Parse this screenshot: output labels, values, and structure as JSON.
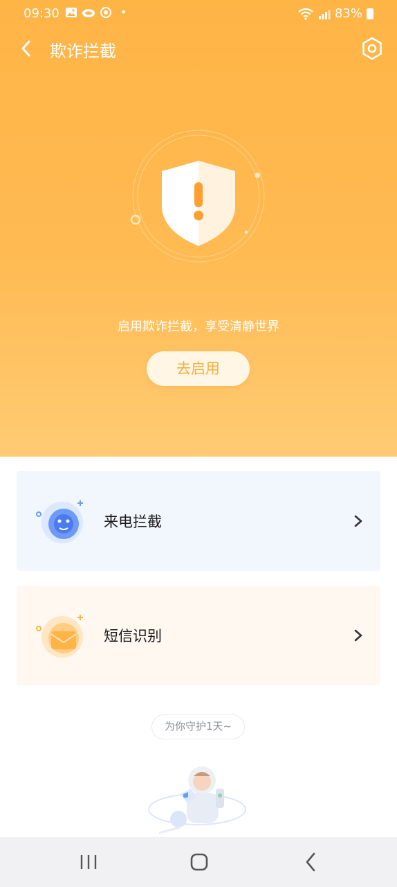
{
  "status_bar": {
    "time": "09:30",
    "dot": "•",
    "battery": "83%",
    "icons": [
      "image-icon",
      "cloud-icon",
      "sync-icon",
      "wifi-icon",
      "signal-icon",
      "battery-icon"
    ]
  },
  "header": {
    "title": "欺诈拦截",
    "back_icon": "chevron-left-icon",
    "settings_icon": "gear-icon"
  },
  "hero": {
    "shield_icon": "warning-shield-icon",
    "message": "启用欺诈拦截，享受清静世界",
    "enable_button": "去启用"
  },
  "cards": [
    {
      "label": "来电拦截",
      "icon": "call-block-icon"
    },
    {
      "label": "短信识别",
      "icon": "sms-identify-icon"
    }
  ],
  "protect_text": "为你守护1天~",
  "colors": {
    "accent": "#FFB446",
    "button_text": "#F7AE3C",
    "call_card_bg": "#F2F6FD",
    "sms_card_bg": "#FEF8F1"
  },
  "nav_bar": {
    "buttons": [
      "recents-icon",
      "home-icon",
      "back-icon"
    ]
  }
}
